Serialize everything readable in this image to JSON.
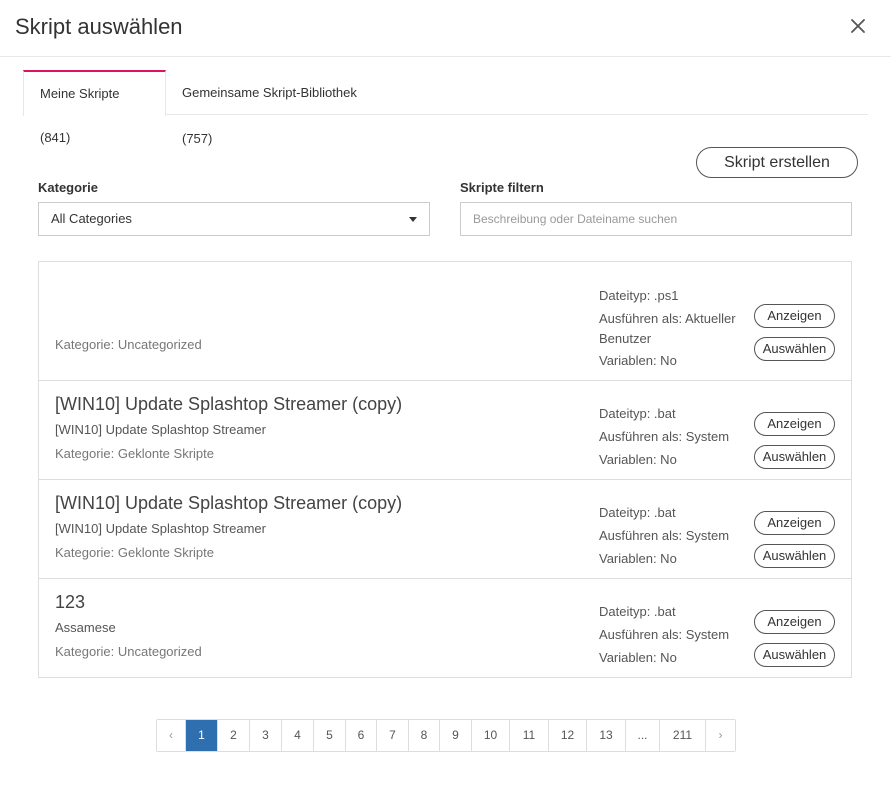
{
  "dialog": {
    "title": "Skript auswählen",
    "close_icon": "close-icon"
  },
  "tabs": [
    {
      "label": "Meine Skripte (841)",
      "active": true
    },
    {
      "label": "Gemeinsame Skript-Bibliothek (757)",
      "active": false
    }
  ],
  "toolbar": {
    "create_label": "Skript erstellen"
  },
  "filters": {
    "category_label": "Kategorie",
    "category_value": "All Categories",
    "filter_label": "Skripte filtern",
    "filter_placeholder": "Beschreibung oder Dateiname suchen",
    "filter_value": ""
  },
  "scripts": [
    {
      "name": "",
      "description": "",
      "category": "Kategorie: Uncategorized",
      "filetype": "Dateityp: .ps1",
      "run_as": "Ausführen als: Aktueller Benutzer",
      "variables": "Variablen: No",
      "view_label": "Anzeigen",
      "select_label": "Auswählen"
    },
    {
      "name": "[WIN10] Update Splashtop Streamer (copy)",
      "description": "[WIN10] Update Splashtop Streamer",
      "category": "Kategorie: Geklonte Skripte",
      "filetype": "Dateityp: .bat",
      "run_as": "Ausführen als: System",
      "variables": "Variablen: No",
      "view_label": "Anzeigen",
      "select_label": "Auswählen"
    },
    {
      "name": "[WIN10] Update Splashtop Streamer (copy)",
      "description": "[WIN10] Update Splashtop Streamer",
      "category": "Kategorie: Geklonte Skripte",
      "filetype": "Dateityp: .bat",
      "run_as": "Ausführen als: System",
      "variables": "Variablen: No",
      "view_label": "Anzeigen",
      "select_label": "Auswählen"
    },
    {
      "name": "123",
      "description": "Assamese",
      "category": "Kategorie: Uncategorized",
      "filetype": "Dateityp: .bat",
      "run_as": "Ausführen als: System",
      "variables": "Variablen: No",
      "view_label": "Anzeigen",
      "select_label": "Auswählen"
    }
  ],
  "pagination": {
    "prev": "‹",
    "next": "›",
    "current": "1",
    "pages": [
      "1",
      "2",
      "3",
      "4",
      "5",
      "6",
      "7",
      "8",
      "9",
      "10",
      "11",
      "12",
      "13",
      "...",
      "211"
    ]
  },
  "colors": {
    "accent_tab": "#e0115f",
    "active_page": "#2f6fb0"
  }
}
